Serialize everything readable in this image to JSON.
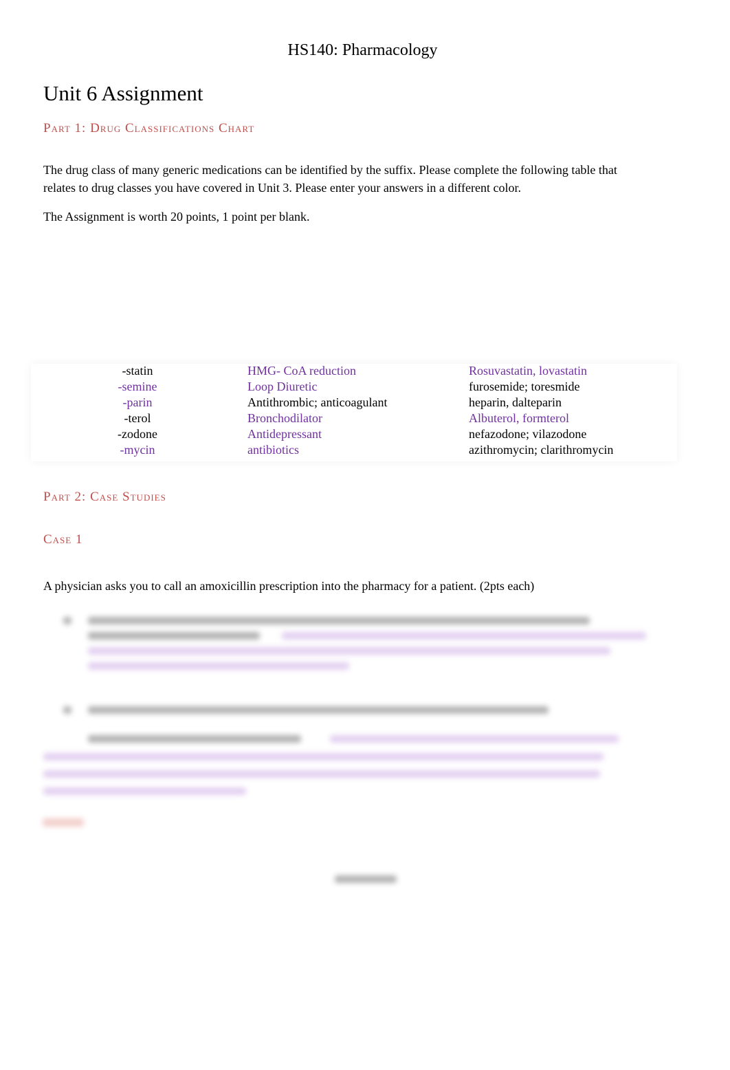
{
  "header": {
    "course": "HS140: Pharmacology"
  },
  "title": "Unit 6 Assignment",
  "part1": {
    "heading": "Part 1: Drug Classifications Chart",
    "intro": "The drug class of many generic medications can be identified by the suffix. Please complete the following table that relates to drug classes you have covered in Unit 3. Please enter your answers in a different color.",
    "points": "The Assignment is worth 20 points, 1 point per blank."
  },
  "colors": {
    "heading": "#c0504d",
    "answer": "#7030a0"
  },
  "table": {
    "rows": [
      {
        "suffix": "-statin",
        "suffix_answer": false,
        "class": "HMG- CoA reduction",
        "class_answer": true,
        "examples": "Rosuvastatin, lovastatin",
        "examples_answer": true
      },
      {
        "suffix": "-semine",
        "suffix_answer": true,
        "class": "Loop Diuretic",
        "class_answer": true,
        "examples": "furosemide; toresmide",
        "examples_answer": false
      },
      {
        "suffix": "-parin",
        "suffix_answer": true,
        "class": "Antithrombic; anticoagulant",
        "class_answer": false,
        "examples": "heparin, dalteparin",
        "examples_answer": false
      },
      {
        "suffix": "-terol",
        "suffix_answer": false,
        "class": "Bronchodilator",
        "class_answer": true,
        "examples": "Albuterol, formterol",
        "examples_answer": true
      },
      {
        "suffix": "-zodone",
        "suffix_answer": false,
        "class": "Antidepressant",
        "class_answer": true,
        "examples": "nefazodone; vilazodone",
        "examples_answer": false
      },
      {
        "suffix": "-mycin",
        "suffix_answer": true,
        "class": "antibiotics",
        "class_answer": true,
        "examples": "azithromycin; clarithromycin",
        "examples_answer": false
      }
    ]
  },
  "part2": {
    "heading": "Part 2: Case Studies",
    "case1": {
      "heading": "Case 1",
      "intro": "A physician asks you to call an amoxicillin prescription into the pharmacy for a patient. (2pts each)"
    }
  }
}
